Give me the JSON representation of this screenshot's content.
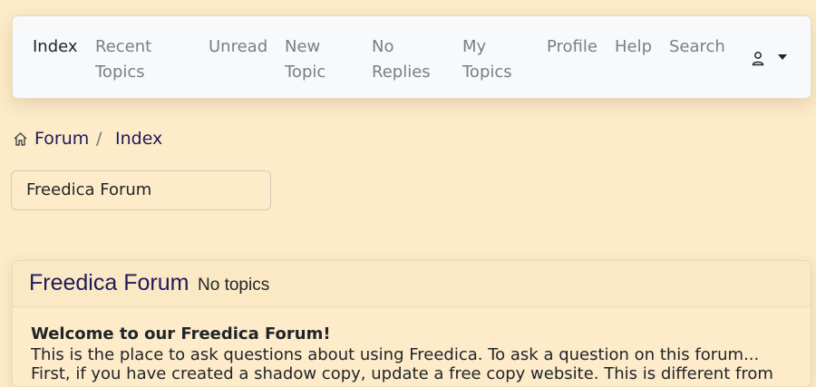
{
  "nav": {
    "items": [
      {
        "label": "Index",
        "active": true
      },
      {
        "label": "Recent Topics"
      },
      {
        "label": "Unread"
      },
      {
        "label": "New Topic"
      },
      {
        "label": "No Replies"
      },
      {
        "label": "My Topics"
      },
      {
        "label": "Profile"
      },
      {
        "label": "Help"
      },
      {
        "label": "Search"
      }
    ],
    "user_icon": "person-icon",
    "dropdown_icon": "caret-down-icon"
  },
  "breadcrumb": {
    "home_icon": "house-icon",
    "forum": "Forum",
    "separator": "/",
    "index": "Index"
  },
  "forum_select": {
    "value": "Freedica Forum"
  },
  "forum_card": {
    "title": "Freedica Forum",
    "count": "No topics",
    "welcome": "Welcome to our Freedica Forum!",
    "description": "This is the place to ask questions about using Freedica. To ask a question on this forum...",
    "description_cut": "First, if you have created a shadow copy, update a free copy website. This is different from"
  },
  "colors": {
    "background": "#fdebc9",
    "navbar": "#f8f9fa",
    "link": "#1f1b5a",
    "muted_nav": "#7a7f85"
  }
}
